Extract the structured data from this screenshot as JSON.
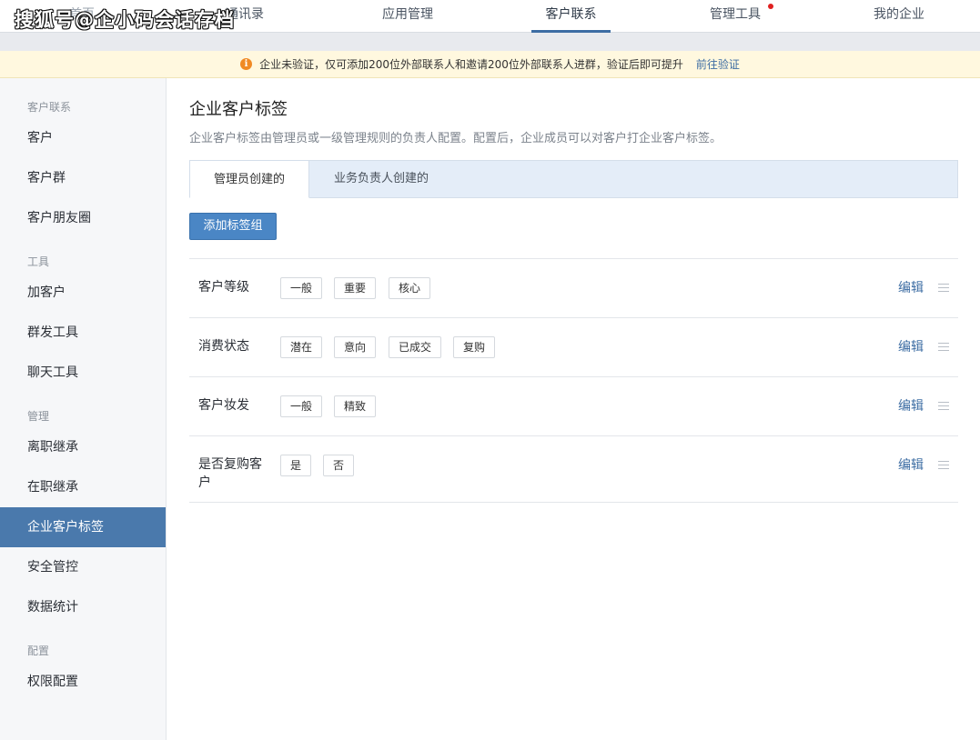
{
  "watermark": "搜狐号@企小码会话存档",
  "nav": {
    "items": [
      {
        "label": "首页"
      },
      {
        "label": "通讯录"
      },
      {
        "label": "应用管理"
      },
      {
        "label": "客户联系"
      },
      {
        "label": "管理工具"
      },
      {
        "label": "我的企业"
      }
    ],
    "active": "客户联系"
  },
  "notice": {
    "icon": "info-icon",
    "text": "企业未验证，仅可添加200位外部联系人和邀请200位外部联系人进群，验证后即可提升",
    "link": "前往验证"
  },
  "sidebar": {
    "groups": [
      {
        "title": "客户联系",
        "items": [
          "客户",
          "客户群",
          "客户朋友圈"
        ]
      },
      {
        "title": "工具",
        "items": [
          "加客户",
          "群发工具",
          "聊天工具"
        ]
      },
      {
        "title": "管理",
        "items": [
          "离职继承",
          "在职继承",
          "企业客户标签",
          "安全管控",
          "数据统计"
        ]
      },
      {
        "title": "配置",
        "items": [
          "权限配置"
        ]
      }
    ],
    "active": "企业客户标签"
  },
  "main": {
    "title": "企业客户标签",
    "description": "企业客户标签由管理员或一级管理规则的负责人配置。配置后，企业成员可以对客户打企业客户标签。",
    "tabs": [
      {
        "label": "管理员创建的"
      },
      {
        "label": "业务负责人创建的"
      }
    ],
    "add_button": "添加标签组",
    "edit_label": "编辑",
    "tag_groups": [
      {
        "name": "客户等级",
        "tags": [
          "一般",
          "重要",
          "核心"
        ]
      },
      {
        "name": "消费状态",
        "tags": [
          "潜在",
          "意向",
          "已成交",
          "复购"
        ]
      },
      {
        "name": "客户妆发",
        "tags": [
          "一般",
          "精致"
        ]
      },
      {
        "name": "是否复购客户",
        "tags": [
          "是",
          "否"
        ]
      }
    ]
  },
  "colors": {
    "accent": "#3d6da3",
    "sidebar_active": "#4a79ac",
    "button": "#4a86c5",
    "notice_bg": "#fff8df",
    "notice_icon": "#f08a24",
    "badge_dot": "#e02020"
  }
}
